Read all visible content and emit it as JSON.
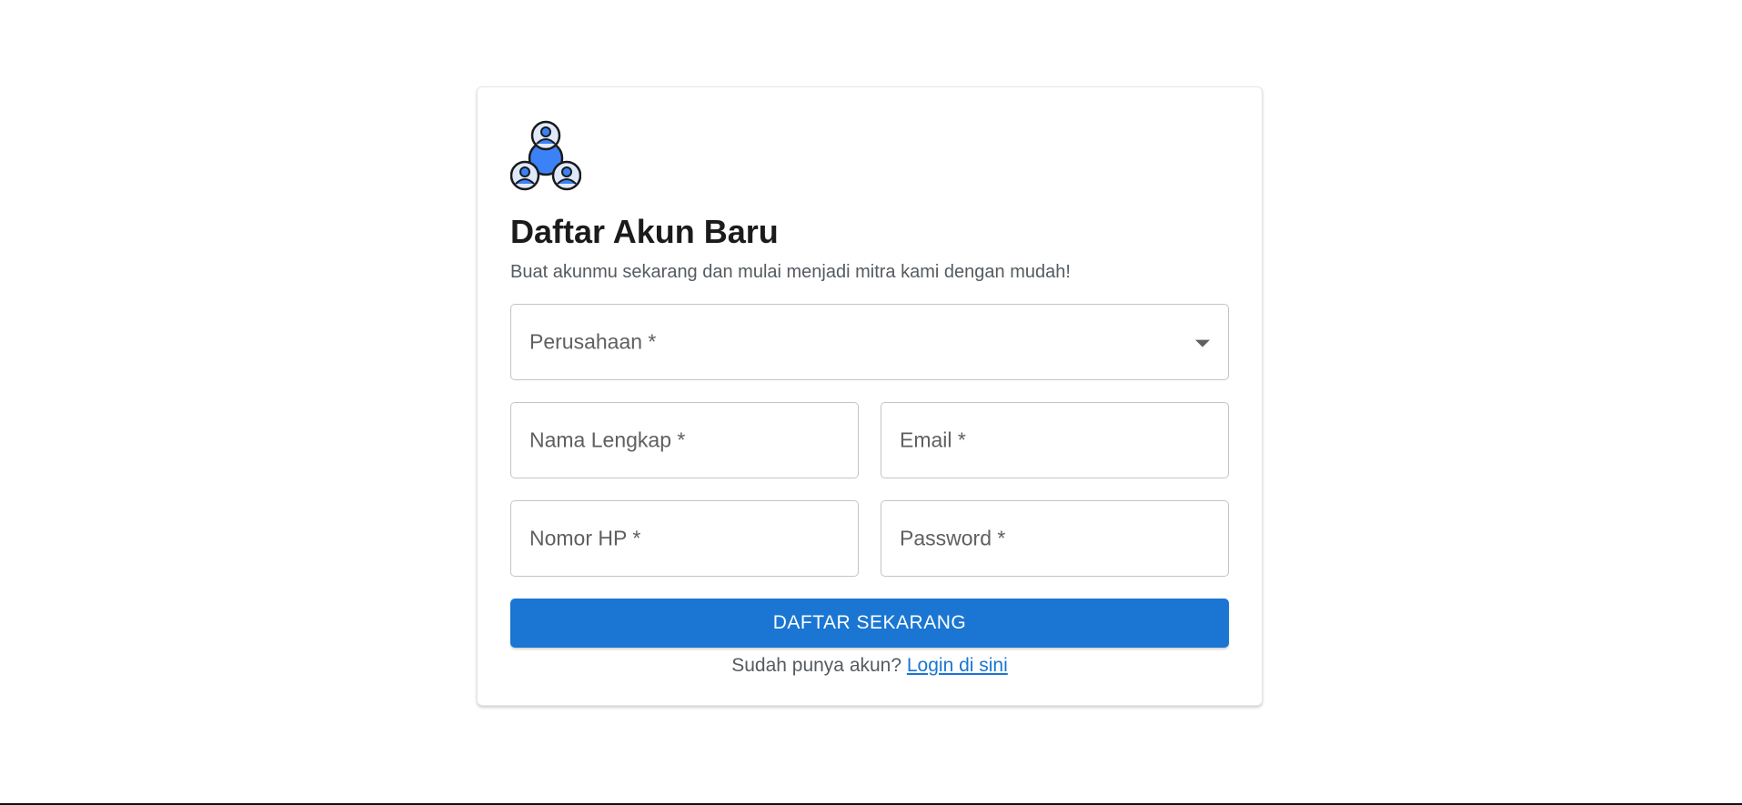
{
  "colors": {
    "primary": "#1a76d2",
    "logo_blue": "#3b82f6"
  },
  "logo": {
    "icon": "team-users-icon"
  },
  "header": {
    "title": "Daftar Akun Baru",
    "subtitle": "Buat akunmu sekarang dan mulai menjadi mitra kami dengan mudah!"
  },
  "form": {
    "company_label": "Perusahaan *",
    "full_name_label": "Nama Lengkap *",
    "email_label": "Email *",
    "phone_label": "Nomor HP *",
    "password_label": "Password *",
    "submit_label": "DAFTAR SEKARANG"
  },
  "footer": {
    "prompt": "Sudah punya akun?",
    "login_link": "Login di sini"
  }
}
